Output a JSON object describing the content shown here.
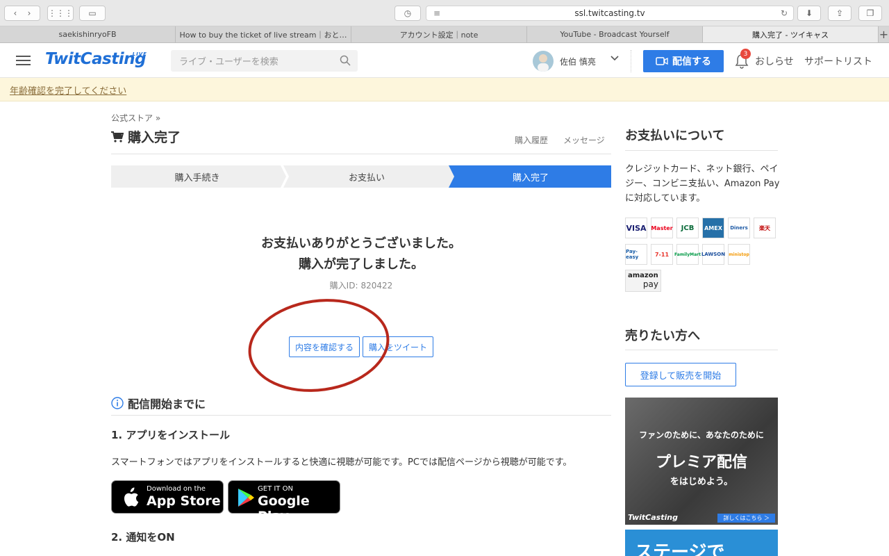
{
  "browser": {
    "url": "ssl.twitcasting.tv",
    "tabs": [
      "saekishinryoFB",
      "How to buy the ticket of live stream｜おと…",
      "アカウント設定｜note",
      "YouTube - Broadcast Yourself",
      "購入完了 - ツイキャス"
    ]
  },
  "header": {
    "logo": "TwitCasting",
    "logo_sup": "LIVE",
    "search_placeholder": "ライブ・ユーザーを検索",
    "user_name": "佐伯 慎亮",
    "live_button": "配信する",
    "notif_count": "3",
    "notif_label": "おしらせ",
    "support_label": "サポートリスト"
  },
  "age_notice": "年齢確認を完了してください",
  "main": {
    "breadcrumb": "公式ストア »",
    "title": "購入完了",
    "history_link": "購入履歴",
    "message_link": "メッセージ",
    "steps": [
      "購入手続き",
      "お支払い",
      "購入完了"
    ],
    "thanks_line1": "お支払いありがとうございました。",
    "thanks_line2": "購入が完了しました。",
    "purchase_id_label": "購入ID:",
    "purchase_id": "820422",
    "confirm_button": "内容を確認する",
    "tweet_button": "購入をツイート",
    "section_title": "配信開始までに",
    "step1_title": "1. アプリをインストール",
    "step1_text": "スマートフォンではアプリをインストールすると快適に視聴が可能です。PCでは配信ページから視聴が可能です。",
    "appstore_small": "Download on the",
    "appstore_big": "App Store",
    "googleplay_small": "GET IT ON",
    "googleplay_big": "Google Play",
    "step2_title": "2. 通知をON"
  },
  "sidebar": {
    "payment_title": "お支払いについて",
    "payment_desc": "クレジットカード、ネット銀行、ペイジー、コンビニ支払い、Amazon Payに対応しています。",
    "payment_logos": [
      "VISA",
      "Master",
      "JCB",
      "AMEX",
      "Diners",
      "楽天",
      "Pay-easy",
      "7-11",
      "FamilyMart",
      "LAWSON",
      "ministop"
    ],
    "amazon_pay": [
      "amazon",
      "pay"
    ],
    "seller_title": "売りたい方へ",
    "seller_button": "登録して販売を開始",
    "banner_line1": "ファンのために、あなたのために",
    "banner_line2": "プレミア配信",
    "banner_line3": "をはじめよう。",
    "banner_logo": "TwitCasting",
    "banner_link": "詳しくはこちら ＞",
    "banner2_text": "ステージで"
  },
  "colors": {
    "accent": "#2e7ce6",
    "highlight_circle": "#b8281c",
    "age_bar": "#fdf6dc"
  }
}
